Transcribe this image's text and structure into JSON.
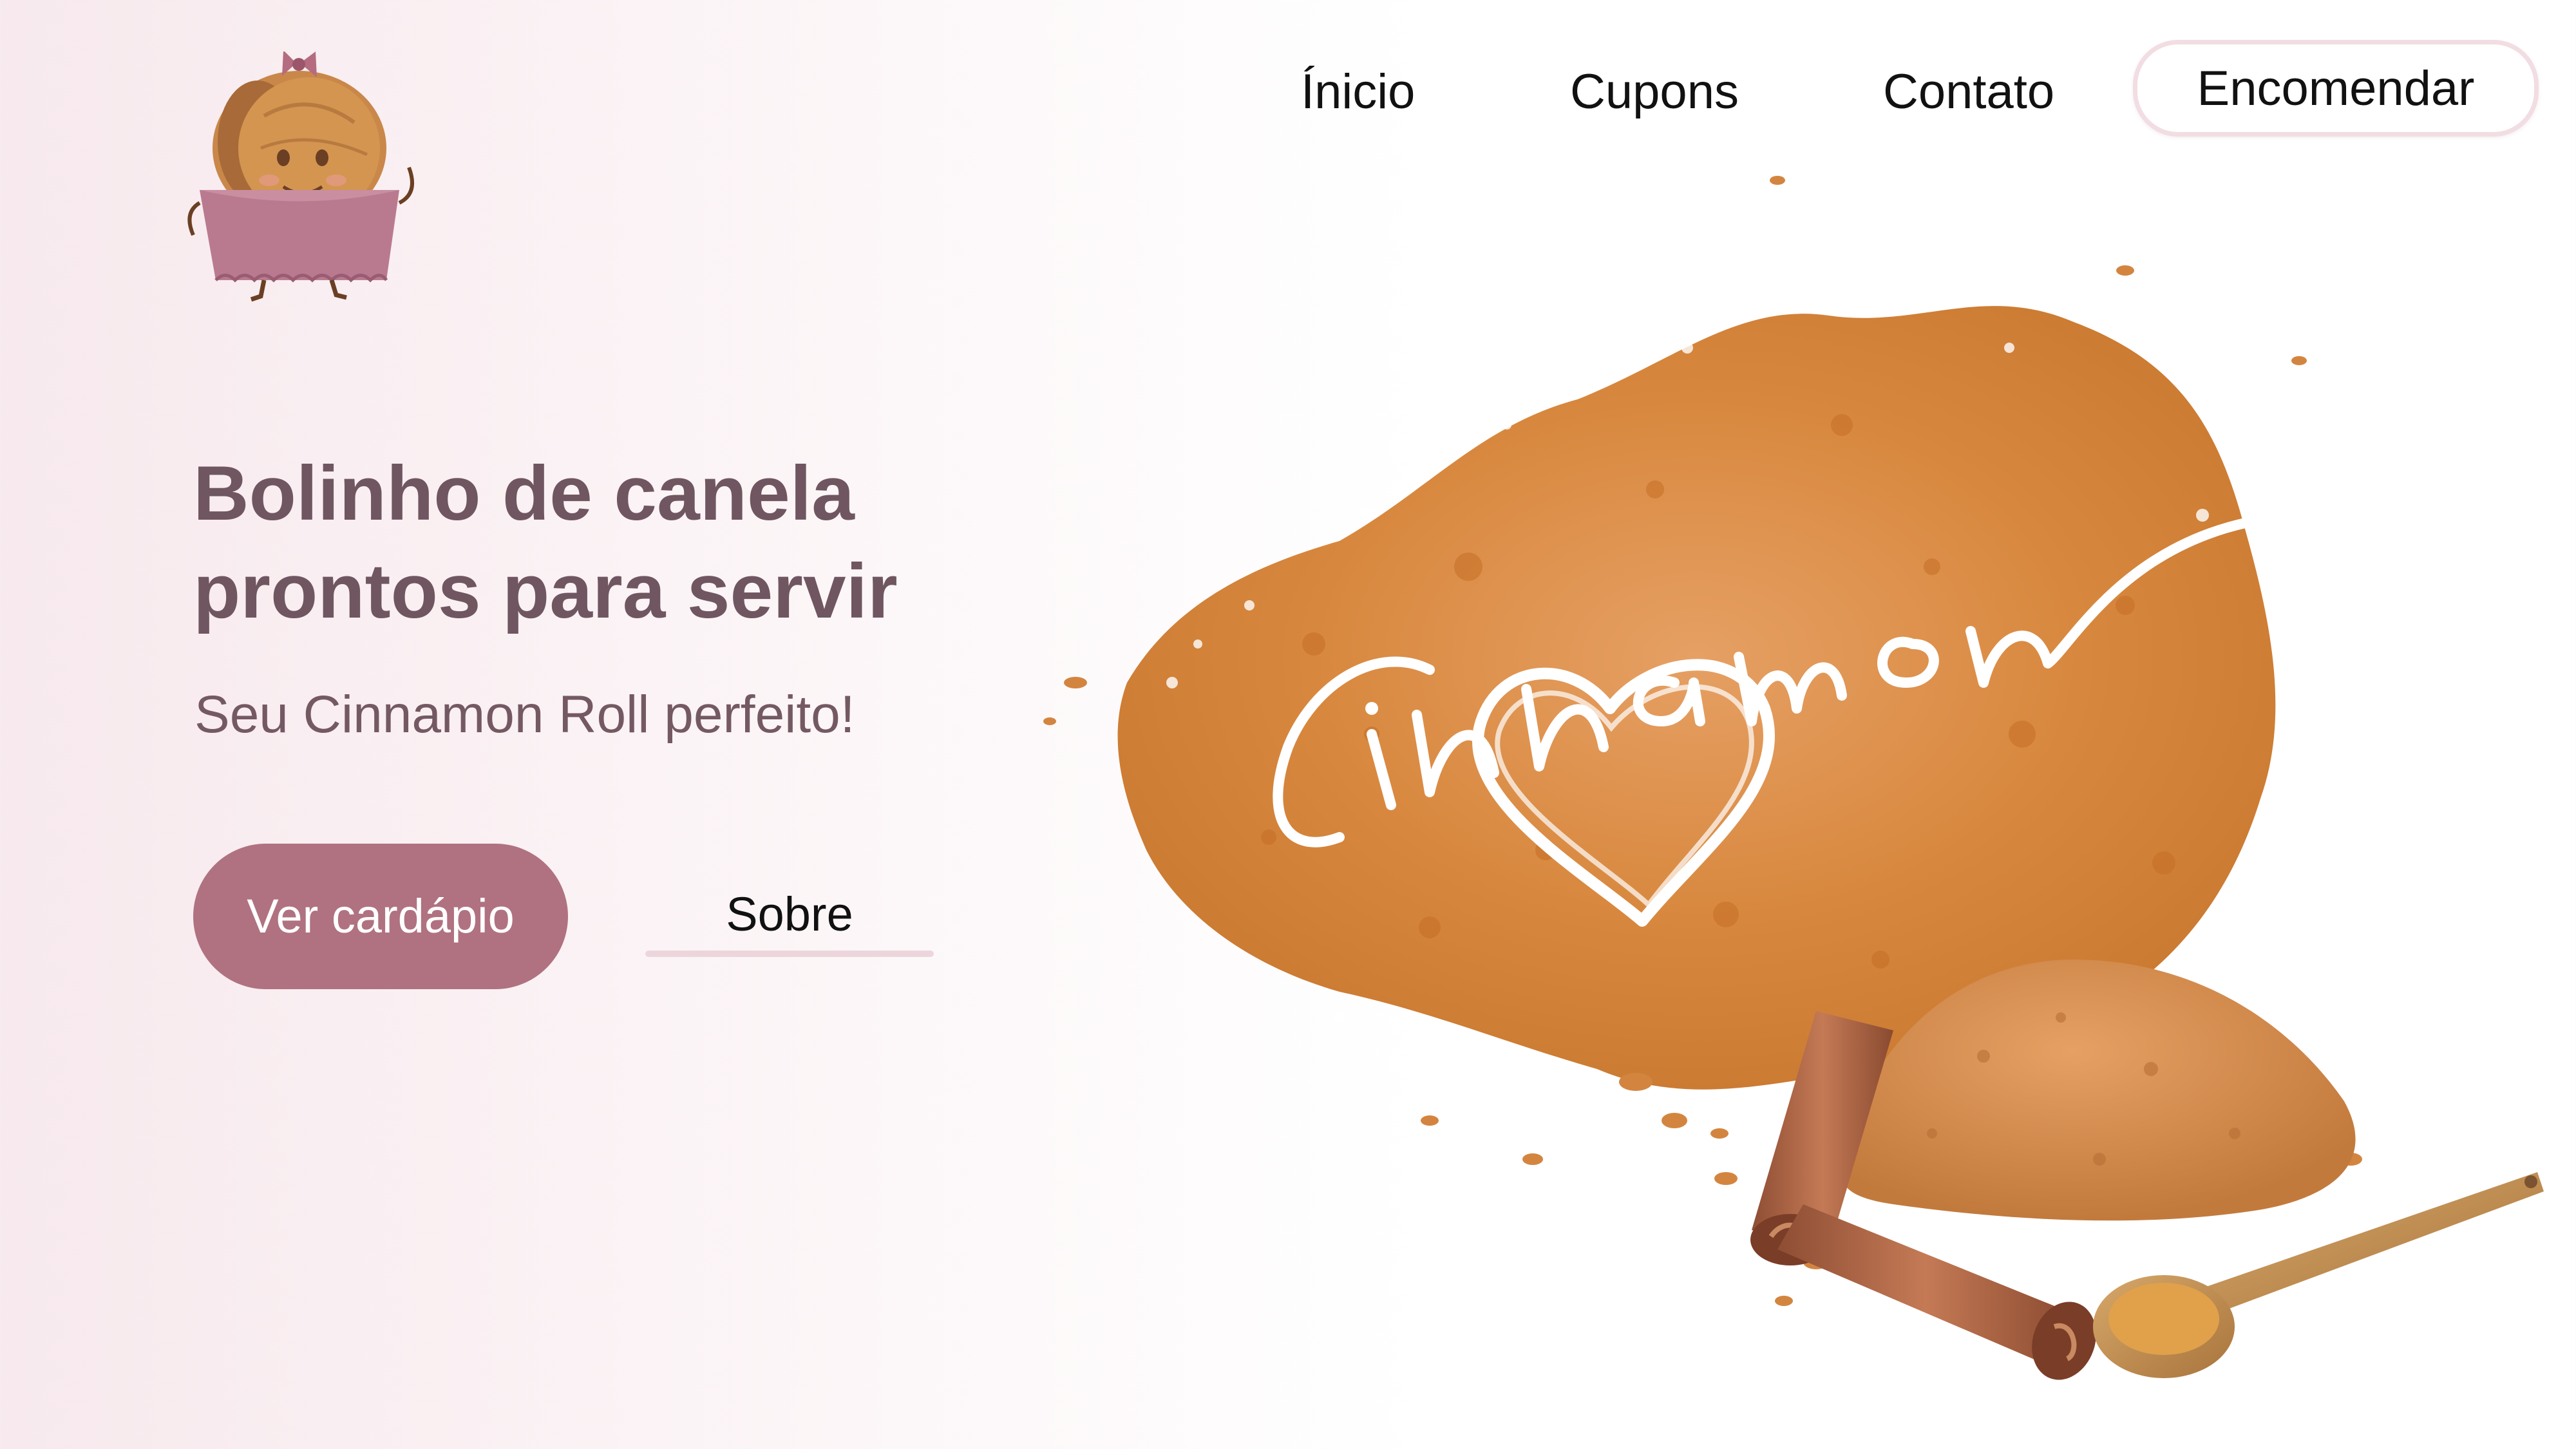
{
  "nav": {
    "items": [
      {
        "label": "Ínicio"
      },
      {
        "label": "Cupons"
      },
      {
        "label": "Contato"
      }
    ],
    "cta_label": "Encomendar"
  },
  "hero": {
    "title_line1": "Bolinho de canela",
    "title_line2": "prontos para servir",
    "subtitle": "Seu Cinnamon Roll perfeito!",
    "primary_button": "Ver cardápio",
    "secondary_link": "Sobre",
    "illustration_script_text": "Cinnamon"
  },
  "colors": {
    "brand_rose": "#b07280",
    "title_text": "#6f5660",
    "cinnamon": "#d9893f",
    "outline_pink": "#f1dde2"
  },
  "icons": {
    "logo": "cinnamon-roll-mascot-icon",
    "illustration": "cinnamon-powder-heart-illustration"
  }
}
